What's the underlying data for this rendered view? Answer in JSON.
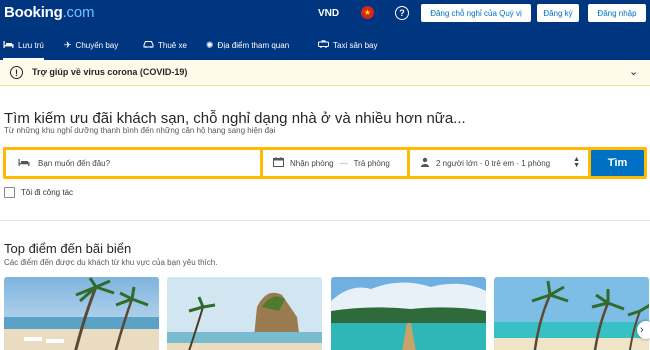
{
  "header": {
    "logo_main": "Booking",
    "logo_suffix": ".com",
    "currency": "VND",
    "list_property": "Đăng chỗ nghỉ của Quý vị",
    "register": "Đăng ký",
    "login": "Đăng nhập"
  },
  "nav": {
    "items": [
      {
        "label": "Lưu trú",
        "icon": "bed-icon"
      },
      {
        "label": "Chuyến bay",
        "icon": "plane-icon"
      },
      {
        "label": "Thuê xe",
        "icon": "car-icon"
      },
      {
        "label": "Địa điểm tham quan",
        "icon": "attractions-icon"
      },
      {
        "label": "Taxi sân bay",
        "icon": "taxi-icon"
      }
    ]
  },
  "covid": {
    "text": "Trợ giúp về virus corona (COVID-19)"
  },
  "search": {
    "title": "Tìm kiếm ưu đãi khách sạn, chỗ nghỉ dạng nhà ở và nhiều hơn nữa...",
    "subtitle": "Từ những khu nghỉ dưỡng thanh bình đến những căn hộ hạng sang hiện đại",
    "destination_placeholder": "Bạn muốn đến đâu?",
    "checkin": "Nhận phòng",
    "date_sep": "—",
    "checkout": "Trả phòng",
    "guests": "2 người lớn · 0 trẻ em · 1 phòng",
    "button": "Tìm",
    "business_travel": "Tôi đi công tác"
  },
  "beach": {
    "title": "Top điểm đến bãi biển",
    "subtitle": "Các điểm đến được du khách từ khu vực của bạn yêu thích."
  },
  "colors": {
    "brand_blue": "#003580",
    "action_blue": "#0071c2",
    "search_yellow": "#febb02"
  }
}
